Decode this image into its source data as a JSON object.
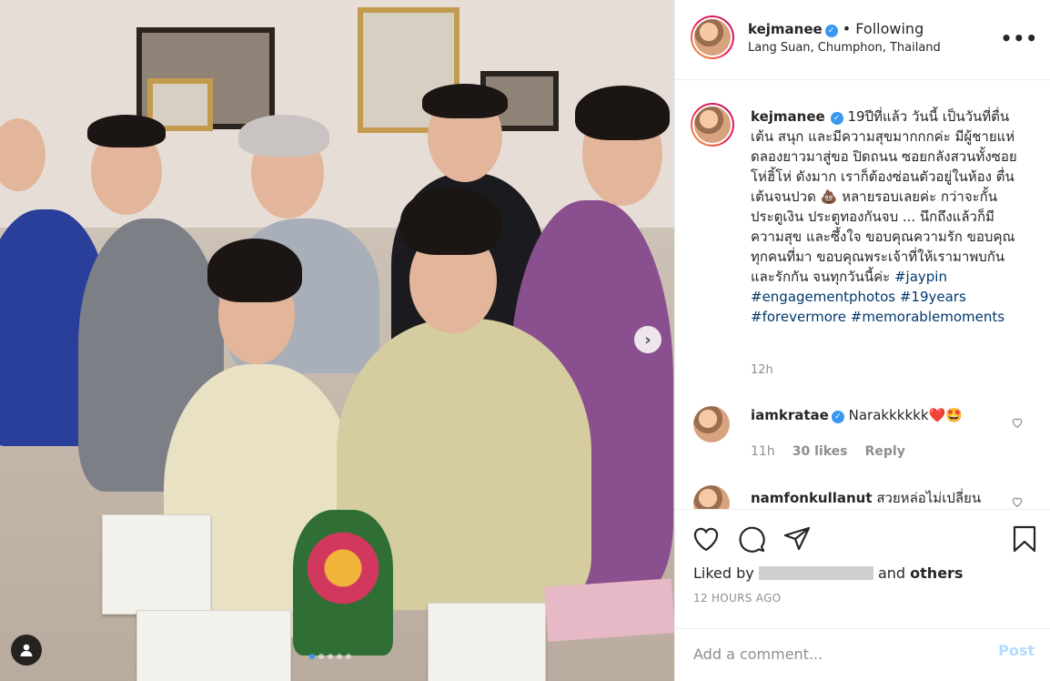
{
  "post": {
    "username": "kejmanee",
    "verified_badge": "✓",
    "separator": "•",
    "follow_status": "Following",
    "location": "Lang Suan, Chumphon, Thailand",
    "more_label": "•••"
  },
  "caption": {
    "username": "kejmanee",
    "text": "19ปีที่แล้ว วันนี้ เป็นวันที่ตื่นเต้น สนุก และมีความสุขมากกกค่ะ มีผู้ชายแห่ดลองยาวมาสู่ขอ ปิดถนน ซอยกลังสวนทั้งซอย โห่ฮิ้โห่ ดังมาก เราก็ต้องซ่อนตัวอยู่ในห้อง ตื่นเต้นจนปวด 💩 หลายรอบเลยค่ะ กว่าจะกั้นประตูเงิน ประตูทองกันจบ ... นึกถึงแล้วก็มีความสุข และซึ้งใจ ขอบคุณความรัก ขอบคุณทุกคนที่มา ขอบคุณพระเจ้าที่ให้เรามาพบกัน และรักกัน จนทุกวันนี้ค่ะ",
    "hashtags": [
      "#jaypin",
      "#engagementphotos",
      "#19years",
      "#forevermore",
      "#memorablemoments"
    ],
    "time": "12h"
  },
  "comments": [
    {
      "username": "iamkratae",
      "verified": true,
      "text": "Narakkkkkk",
      "emoji": "❤️🤩",
      "time": "11h",
      "likes": "30 likes",
      "reply_label": "Reply"
    },
    {
      "username": "namfonkullanut",
      "text": "สวยหล่อไม่เปลี่ยน"
    }
  ],
  "actions": {
    "liked_by_prefix": "Liked by",
    "liked_by_suffix": "and",
    "others_label": "others",
    "posted_time": "12 HOURS AGO"
  },
  "comment_box": {
    "placeholder": "Add a comment...",
    "post_label": "Post"
  },
  "carousel": {
    "next_label": "›",
    "total_slides": 5,
    "active_slide": 1
  }
}
